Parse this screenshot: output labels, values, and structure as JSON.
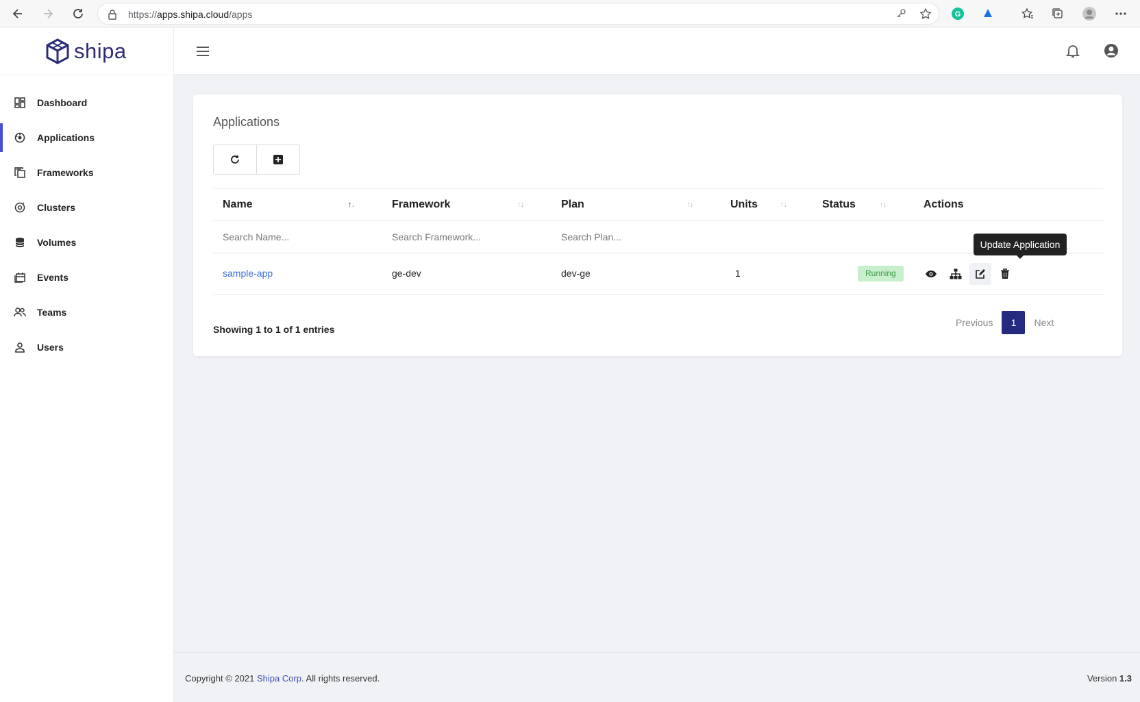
{
  "browser": {
    "url_scheme": "https://",
    "url_host": "apps.shipa.cloud",
    "url_path": "/apps"
  },
  "sidebar": {
    "logo_text": "shipa",
    "items": [
      {
        "label": "Dashboard",
        "icon": "dashboard-icon"
      },
      {
        "label": "Applications",
        "icon": "applications-icon",
        "active": true
      },
      {
        "label": "Frameworks",
        "icon": "frameworks-icon"
      },
      {
        "label": "Clusters",
        "icon": "clusters-icon"
      },
      {
        "label": "Volumes",
        "icon": "volumes-icon"
      },
      {
        "label": "Events",
        "icon": "events-icon"
      },
      {
        "label": "Teams",
        "icon": "teams-icon"
      },
      {
        "label": "Users",
        "icon": "users-icon"
      }
    ]
  },
  "card": {
    "title": "Applications"
  },
  "table": {
    "columns": [
      "Name",
      "Framework",
      "Plan",
      "Units",
      "Status",
      "Actions"
    ],
    "search_placeholders": {
      "name": "Search Name...",
      "framework": "Search Framework...",
      "plan": "Search Plan..."
    },
    "rows": [
      {
        "name": "sample-app",
        "framework": "ge-dev",
        "plan": "dev-ge",
        "units": "1",
        "status": "Running"
      }
    ]
  },
  "tooltip": "Update Application",
  "pagination": {
    "info": "Showing 1 to 1 of 1 entries",
    "previous": "Previous",
    "current": "1",
    "next": "Next"
  },
  "footer": {
    "copyright_prefix": "Copyright © 2021 ",
    "corp": "Shipa Corp",
    "copyright_suffix": ". All rights reserved.",
    "version_label": "Version ",
    "version": "1.3"
  },
  "colors": {
    "accent": "#4b4bd9",
    "brand": "#2b2c7a",
    "link": "#3b6fd8",
    "status_running_bg": "#c8efcc",
    "status_running_text": "#3a9a47"
  }
}
